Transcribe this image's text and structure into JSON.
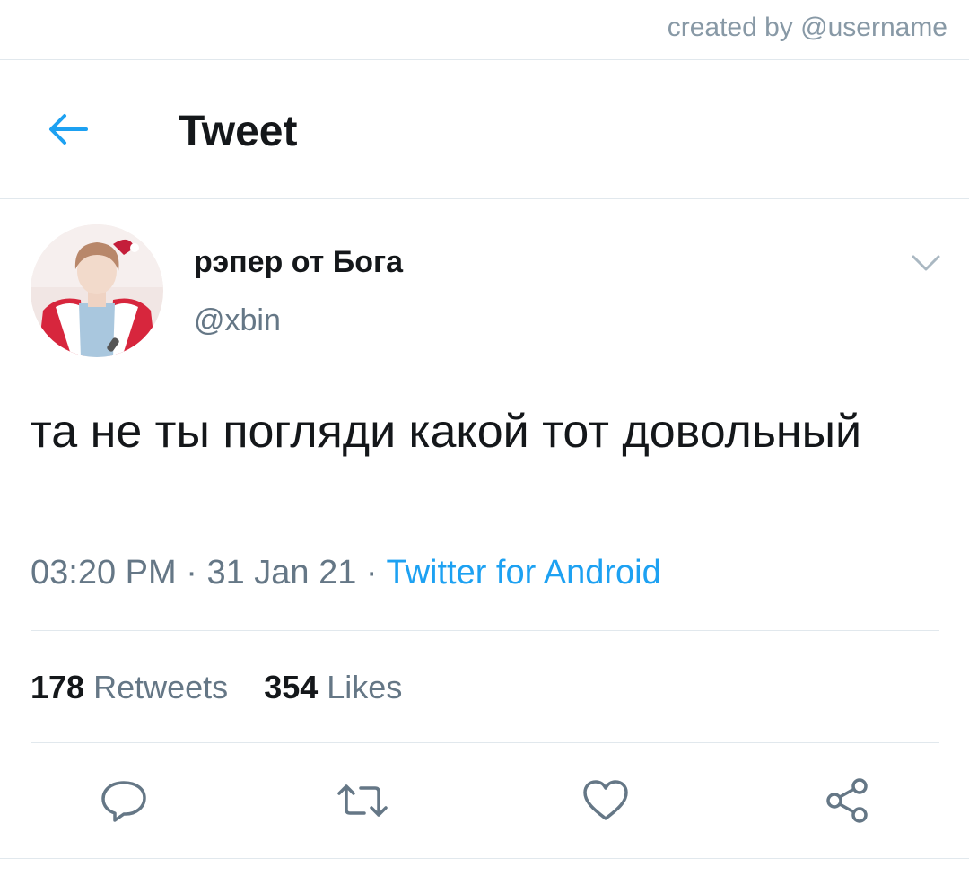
{
  "watermark": "created by @username",
  "header": {
    "title": "Tweet",
    "back_icon": "arrow-left-icon"
  },
  "tweet": {
    "display_name": "рэпер от Бога",
    "handle": "@xbin",
    "text": "та не ты погляди какой тот довольный",
    "time": "03:20 PM",
    "date": "31 Jan 21",
    "separator": " · ",
    "source": "Twitter for Android"
  },
  "stats": {
    "retweets_count": "178",
    "retweets_label": "Retweets",
    "likes_count": "354",
    "likes_label": "Likes"
  },
  "actions": {
    "icons": [
      "reply-icon",
      "retweet-icon",
      "like-icon",
      "share-icon"
    ]
  },
  "colors": {
    "accent": "#1da1f2",
    "text": "#14171a",
    "muted": "#657786",
    "divider": "#e1e8ed"
  }
}
